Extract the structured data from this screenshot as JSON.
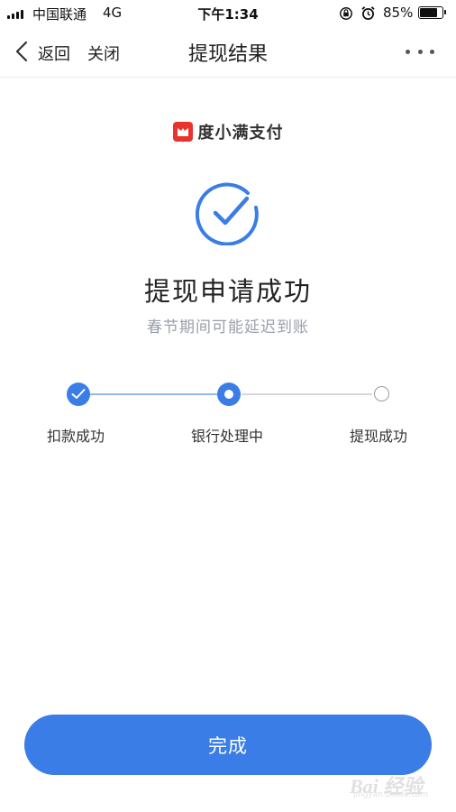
{
  "status_bar": {
    "carrier": "中国联通",
    "network": "4G",
    "time": "下午1:34",
    "battery_percent": "85%",
    "battery_level": 0.85,
    "icons": [
      "signal-icon",
      "rotation-lock-icon",
      "alarm-icon",
      "battery-icon"
    ]
  },
  "nav": {
    "back_label": "返回",
    "close_label": "关闭",
    "title": "提现结果",
    "more_icon": "more-icon"
  },
  "brand": {
    "name": "度小满支付",
    "logo_color": "#e8332e"
  },
  "result": {
    "icon": "check-circle-icon",
    "title": "提现申请成功",
    "subtitle": "春节期间可能延迟到账"
  },
  "steps": [
    {
      "label": "扣款成功",
      "state": "done"
    },
    {
      "label": "银行处理中",
      "state": "current"
    },
    {
      "label": "提现成功",
      "state": "pending"
    }
  ],
  "done_button": {
    "label": "完成"
  },
  "watermark": {
    "text": "Bai 经验",
    "sub": "jingyan.baidu.com"
  },
  "colors": {
    "accent": "#3b7de6",
    "text_primary": "#222222",
    "text_secondary": "#9a9fab",
    "pending": "#9b9b9b"
  }
}
